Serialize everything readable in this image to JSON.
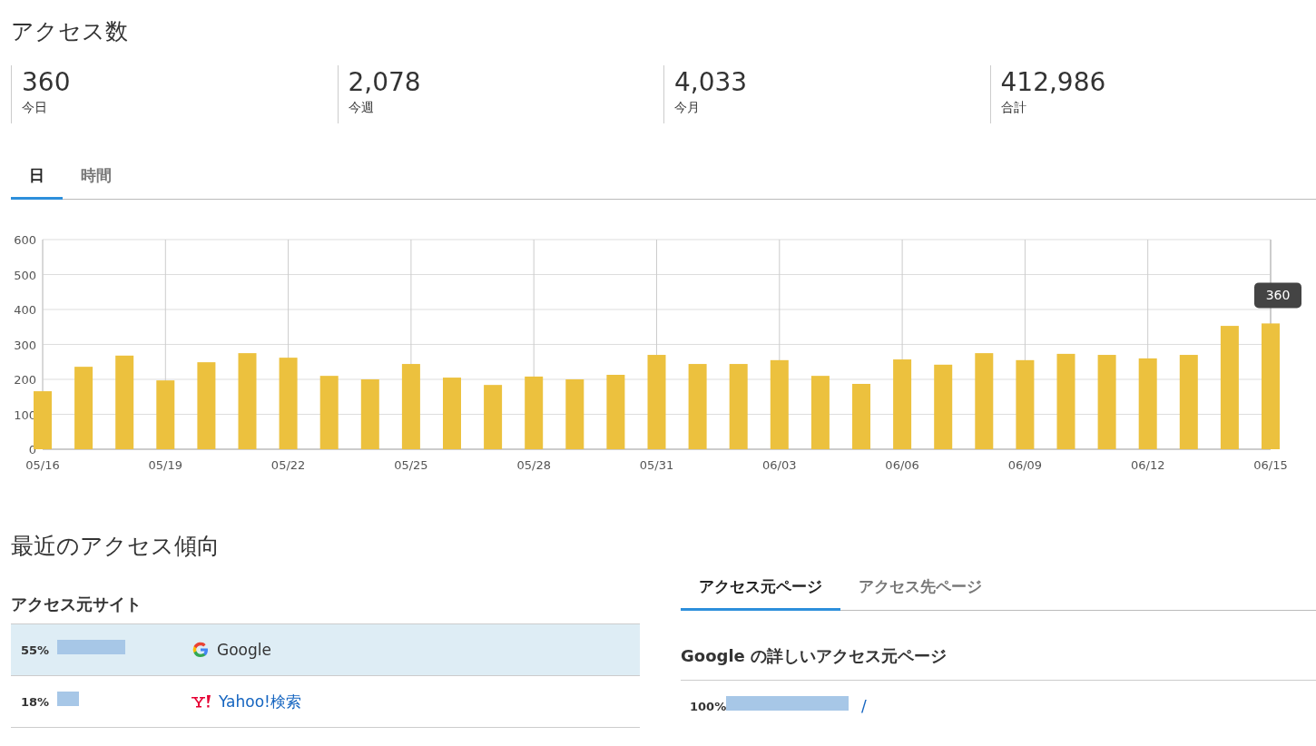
{
  "title": "アクセス数",
  "stats": [
    {
      "value": "360",
      "label": "今日"
    },
    {
      "value": "2,078",
      "label": "今週"
    },
    {
      "value": "4,033",
      "label": "今月"
    },
    {
      "value": "412,986",
      "label": "合計"
    }
  ],
  "chart_tabs": [
    {
      "label": "日",
      "selected": true
    },
    {
      "label": "時間",
      "selected": false
    }
  ],
  "chart": {
    "chart_data": {
      "type": "bar",
      "categories": [
        "05/16",
        null,
        null,
        "05/19",
        null,
        null,
        "05/22",
        null,
        null,
        "05/25",
        null,
        null,
        "05/28",
        null,
        null,
        "05/31",
        null,
        null,
        "06/03",
        null,
        null,
        "06/06",
        null,
        null,
        "06/09",
        null,
        null,
        "06/12",
        null,
        null,
        "06/15"
      ],
      "grid": true,
      "series": [
        {
          "color": "#ecc13e",
          "values": [
            166,
            236,
            268,
            197,
            249,
            275,
            262,
            210,
            200,
            244,
            205,
            184,
            208,
            200,
            213,
            270,
            244,
            244,
            255,
            210,
            187,
            257,
            242,
            275,
            255,
            273,
            270,
            260,
            270,
            353,
            360
          ]
        }
      ],
      "ylim": [
        0,
        600
      ],
      "yticks": [
        0,
        100,
        200,
        300,
        400,
        500,
        600
      ],
      "annotations": [
        {
          "x": "06/15",
          "y": 360,
          "text": "360"
        }
      ]
    }
  },
  "trend": {
    "title": "最近のアクセス傾向",
    "sites": {
      "title": "アクセス元サイト",
      "rows": [
        {
          "percent": "55%",
          "level": 0.55,
          "kind": "google",
          "name": "Google",
          "selected": true
        },
        {
          "percent": "18%",
          "level": 0.18,
          "kind": "yahoo",
          "name": "Yahoo!検索",
          "selected": false
        }
      ]
    },
    "pages": {
      "tabs": [
        {
          "label": "アクセス元ページ",
          "selected": true
        },
        {
          "label": "アクセス先ページ",
          "selected": false
        }
      ],
      "subtitle": "Google の詳しいアクセス元ページ",
      "rows": [
        {
          "percent": "100%",
          "level": 1,
          "path": "/"
        }
      ]
    }
  }
}
